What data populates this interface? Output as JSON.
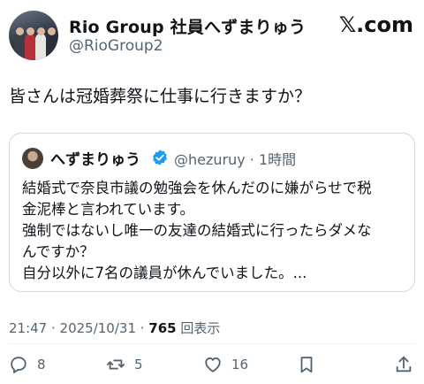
{
  "author": {
    "display_name": "Rio Group 社員へずまりゅう",
    "handle": "@RioGroup2"
  },
  "site_logo": "𝕏.com",
  "tweet": {
    "text": "皆さんは冠婚葬祭に仕事に行きますか？"
  },
  "quote": {
    "name": "へずまりゅう",
    "verified": true,
    "meta": "@hezuruy · 1時間",
    "lines": [
      "結婚式で奈良市議の勉強会を休んだのに嫌がらせで税",
      "金泥棒と言われています。",
      "強制ではないし唯一の友達の結婚式に行ったらダメな",
      "んですか？",
      "自分以外に7名の議員が休んでいました。..."
    ]
  },
  "stamp": {
    "time": "21:47 · 2025/10/31 · ",
    "views": "765",
    "views_label": " 回表示"
  },
  "actions": {
    "replies": "8",
    "reposts": "5",
    "likes": "16"
  },
  "colors": {
    "text": "#0f1419",
    "secondary": "#536471",
    "border": "#cfd9de",
    "verified": "#1d9bf0"
  },
  "icons": [
    "reply-icon",
    "repost-icon",
    "like-icon",
    "bookmark-icon",
    "share-icon",
    "verified-badge-icon"
  ]
}
